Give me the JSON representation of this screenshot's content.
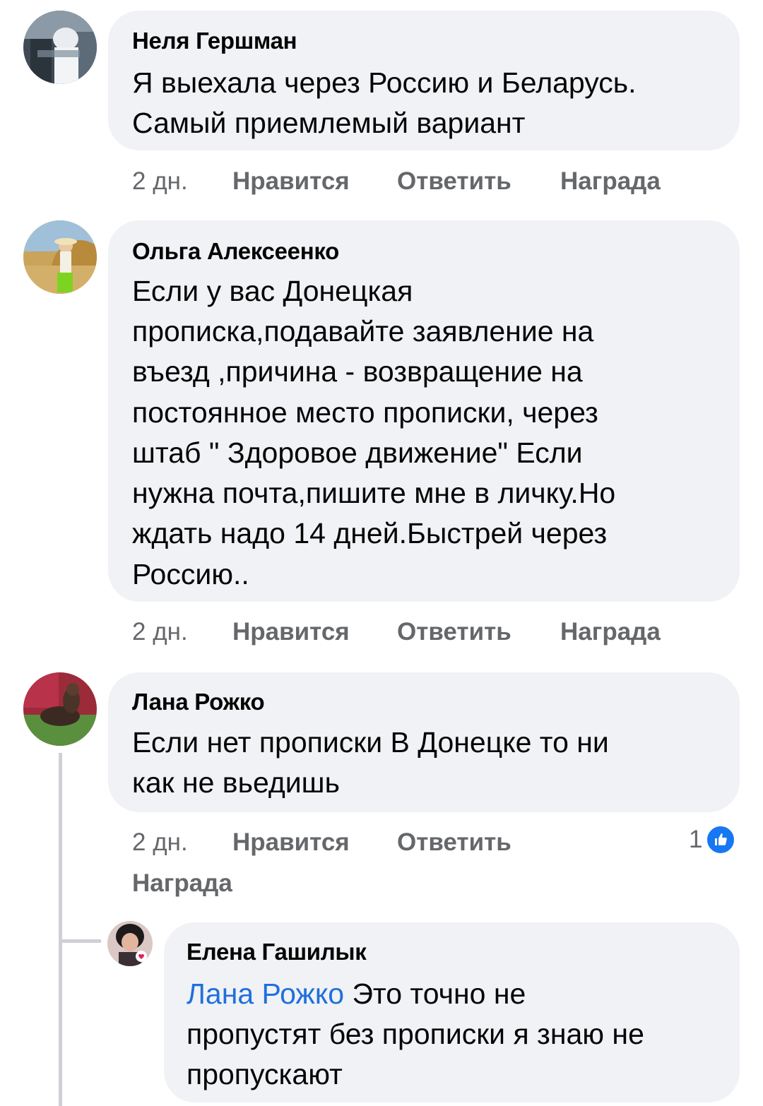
{
  "comments": [
    {
      "author": "Неля Гершман",
      "lines": [
        "Я выехала через Россию и  Беларусь.",
        "Самый приемлемый вариант"
      ],
      "time": "2 дн.",
      "like_label": "Нравится",
      "reply_label": "Ответить",
      "award_label": "Награда"
    },
    {
      "author": "Ольга Алексеенко",
      "lines": [
        "Если у вас Донецкая",
        "прописка,подавайте заявление на",
        "въезд ,причина - возвращение на",
        "постоянное место прописки, через",
        "штаб \" Здоровое движение\" Если",
        "нужна почта,пишите мне в личку.Но",
        "ждать надо 14 дней.Быстрей через",
        "Россию.."
      ],
      "time": "2 дн.",
      "like_label": "Нравится",
      "reply_label": "Ответить",
      "award_label": "Награда"
    },
    {
      "author": "Лана Рожко",
      "lines": [
        "Если нет прописки В Донецке то ни",
        "как не вьедишь"
      ],
      "time": "2 дн.",
      "like_label": "Нравится",
      "reply_label": "Ответить",
      "award_label": "Награда",
      "reaction_count": "1",
      "reaction_icon": "thumbs-up-icon",
      "reaction_color": "#1877f2"
    }
  ],
  "reply": {
    "author": "Елена Гашилык",
    "mention": "Лана Рожко",
    "lines": [
      " Это точно не",
      "пропустят без прописки я знаю не",
      "пропускают"
    ]
  },
  "colors": {
    "bubble": "#f0f2f5",
    "meta_text": "#65676b",
    "mention": "#216fdb",
    "text": "#050505"
  }
}
